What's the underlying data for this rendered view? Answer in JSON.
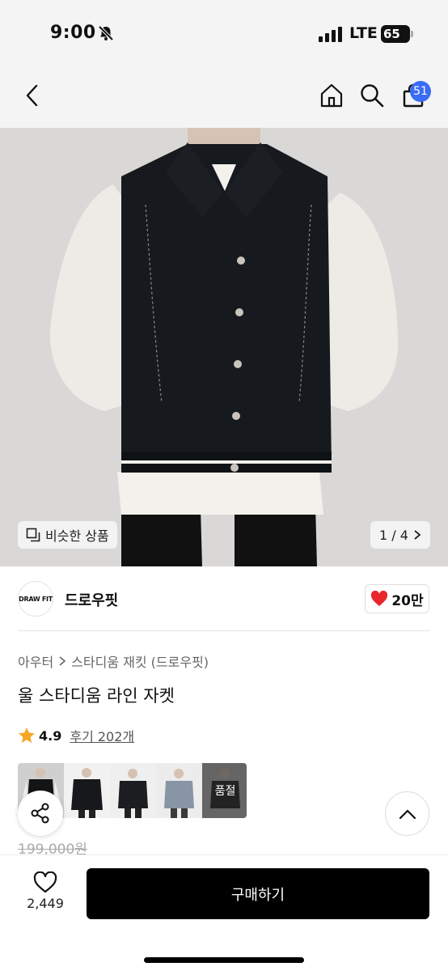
{
  "status": {
    "time": "9:00",
    "network": "LTE",
    "battery": "65"
  },
  "nav": {
    "cart_count": "51"
  },
  "hero": {
    "similar_label": "비슷한 상품",
    "page_counter": "1 / 4"
  },
  "brand": {
    "logo_text": "DRAW FIT",
    "name": "드로우핏",
    "likes": "20만"
  },
  "product": {
    "breadcrumb": [
      "아우터",
      "스타디움 재킷 (드로우핏)"
    ],
    "title": "울 스타디움 라인 자켓",
    "rating": "4.9",
    "review_link": "후기 202개",
    "soldout_label": "품절",
    "original_price": "199,000원"
  },
  "bottom": {
    "wish_count": "2,449",
    "buy_label": "구매하기"
  },
  "colors": {
    "accent": "#3b6cf6",
    "heart": "#e8262b",
    "star": "#f5a623"
  }
}
